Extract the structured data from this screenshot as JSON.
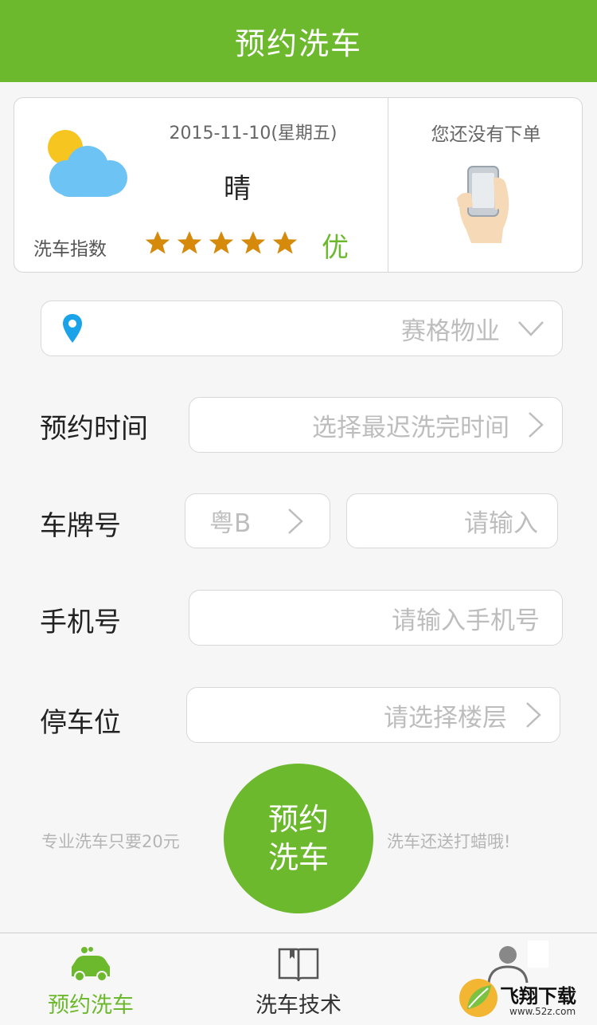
{
  "header": {
    "title": "预约洗车"
  },
  "weather": {
    "date": "2015-11-10(星期五)",
    "condition": "晴",
    "index_label": "洗车指数",
    "stars": 5,
    "rating": "优",
    "icon": "partly-cloudy-icon"
  },
  "order": {
    "status_text": "您还没有下单",
    "icon": "phone-in-hand-icon"
  },
  "form": {
    "location": {
      "value": "赛格物业",
      "icon": "location-pin-icon"
    },
    "time": {
      "label": "预约时间",
      "placeholder": "选择最迟洗完时间"
    },
    "plate": {
      "label": "车牌号",
      "prefix": "粤B",
      "placeholder": "请输入"
    },
    "phone": {
      "label": "手机号",
      "placeholder": "请输入手机号"
    },
    "parking": {
      "label": "停车位",
      "placeholder": "请选择楼层"
    }
  },
  "book_button": {
    "line1": "预约",
    "line2": "洗车"
  },
  "promo": {
    "left": "专业洗车只要20元",
    "right": "洗车还送打蜡哦!"
  },
  "tabs": [
    {
      "label": "预约洗车",
      "icon": "car-wash-icon",
      "active": true
    },
    {
      "label": "洗车技术",
      "icon": "book-icon",
      "active": false
    },
    {
      "label": "",
      "icon": "user-icon",
      "active": false
    }
  ],
  "watermark": {
    "text": "飞翔下载",
    "url": "www.52z.com"
  },
  "colors": {
    "accent": "#6cb92e",
    "star": "#d68a0c",
    "pin": "#1aa3e8",
    "placeholder": "#bdbdbd"
  }
}
